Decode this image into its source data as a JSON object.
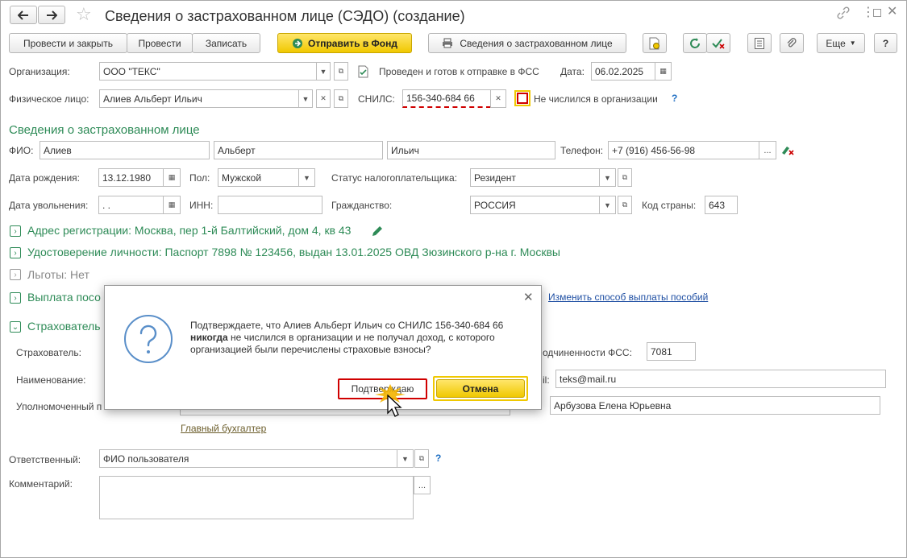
{
  "window": {
    "title": "Сведения о застрахованном лице (СЭДО) (создание)"
  },
  "toolbar": {
    "post_close": "Провести и закрыть",
    "post": "Провести",
    "save": "Записать",
    "send_fund": "Отправить в Фонд",
    "insured_info": "Сведения о застрахованном лице",
    "more": "Еще",
    "help": "?"
  },
  "header": {
    "org_label": "Организация:",
    "org_value": "ООО \"ТЕКС\"",
    "status_text": "Проведен и готов к отправке в ФСС",
    "date_label": "Дата:",
    "date_value": "06.02.2025",
    "person_label": "Физическое лицо:",
    "person_value": "Алиев Альберт Ильич",
    "snils_label": "СНИЛС:",
    "snils_value": "156-340-684 66",
    "not_listed_label": "Не числился в организации",
    "help_q": "?"
  },
  "insured": {
    "section_title": "Сведения о застрахованном лице",
    "fio_label": "ФИО:",
    "last_name": "Алиев",
    "first_name": "Альберт",
    "middle_name": "Ильич",
    "phone_label": "Телефон:",
    "phone_value": "+7 (916) 456-56-98",
    "birth_label": "Дата рождения:",
    "birth_value": "13.12.1980",
    "gender_label": "Пол:",
    "gender_value": "Мужской",
    "tax_status_label": "Статус налогоплательщика:",
    "tax_status_value": "Резидент",
    "dismiss_label": "Дата увольнения:",
    "dismiss_value": " .  .",
    "inn_label": "ИНН:",
    "inn_value": "",
    "citizenship_label": "Гражданство:",
    "citizenship_value": "РОССИЯ",
    "country_code_label": "Код страны:",
    "country_code_value": "643"
  },
  "sections": {
    "address": "Адрес регистрации: Москва, пер 1-й Балтийский, дом 4, кв 43",
    "identity": "Удостоверение личности: Паспорт 7898 № 123456, выдан 13.01.2025 ОВД Зюзинского р-на г. Москвы",
    "benefits": "Льготы: Нет",
    "payment": "Выплата посо",
    "change_payment_link": "Изменить способ выплаты пособий",
    "insurer": "Страхователь"
  },
  "insurer": {
    "insurer_label": "Страхователь:",
    "name_label": "Наименование:",
    "authorized_label": "Уполномоченный п",
    "fss_label": "одчиненности ФСС:",
    "fss_value": "7081",
    "email_label": "il:",
    "email_value": "teks@mail.ru",
    "auth_person_value": "Арбузова Елена Юрьевна",
    "chief_accountant_link": "Главный бухгалтер"
  },
  "footer": {
    "responsible_label": "Ответственный:",
    "responsible_value": "ФИО пользователя",
    "comment_label": "Комментарий:",
    "comment_value": ""
  },
  "dialog": {
    "text_part1": "Подтверждаете, что Алиев Альберт Ильич со СНИЛС 156-340-684 66 ",
    "text_bold": "никогда",
    "text_part2": " не числился в организации и не получал доход, с которого организацией были перечислены страховые взносы?",
    "confirm": "Подтверждаю",
    "cancel": "Отмена"
  }
}
